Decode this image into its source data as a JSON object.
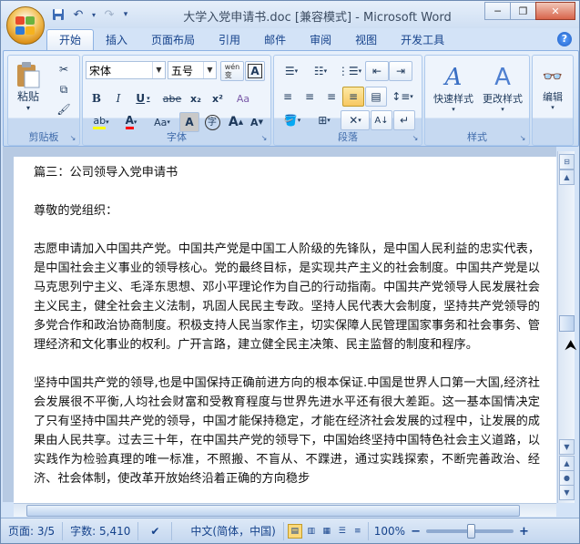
{
  "window": {
    "title": "大学入党申请书.doc [兼容模式] - Microsoft Word"
  },
  "tabs": [
    "开始",
    "插入",
    "页面布局",
    "引用",
    "邮件",
    "审阅",
    "视图",
    "开发工具"
  ],
  "ribbon": {
    "clipboard": {
      "label": "剪贴板",
      "paste": "粘贴"
    },
    "font": {
      "label": "字体",
      "font_name": "宋体",
      "font_size": "五号",
      "wen": "wén\n变",
      "a_box": "A",
      "bold": "B",
      "italic": "I",
      "underline": "U",
      "strike": "abe",
      "sub": "x₂",
      "sup": "x²",
      "clear": "Aa",
      "big_a": "A",
      "small_a": "A",
      "char_shade": "A",
      "char_circle": "字"
    },
    "paragraph": {
      "label": "段落"
    },
    "styles": {
      "label": "样式",
      "quick": "快速样式",
      "change": "更改样式"
    },
    "edit": {
      "label": "编辑"
    }
  },
  "document": {
    "paragraphs": [
      "篇三：公司领导入党申请书",
      "",
      "尊敬的党组织：",
      "",
      "志愿申请加入中国共产党。中国共产党是中国工人阶级的先锋队，是中国人民利益的忠实代表，  是中国社会主义事业的领导核心。党的最终目标，是实现共产主义的社会制度。中国共产党是以马克思列宁主义、毛泽东思想、邓小平理论作为自己的行动指南。中国共产党领导人民发展社会主义民主，健全社会主义法制，巩固人民民主专政。坚持人民代表大会制度，坚持共产党领导的多党合作和政治协商制度。积极支持人民当家作主，切实保障人民管理国家事务和社会事务、管理经济和文化事业的权利。广开言路，建立健全民主决策、民主监督的制度和程序。",
      "",
      "坚持中国共产党的领导,也是中国保持正确前进方向的根本保证.中国是世界人口第一大国,经济社会发展很不平衡,人均社会财富和受教育程度与世界先进水平还有很大差距。这一基本国情决定了只有坚持中国共产党的领导，中国才能保持稳定，才能在经济社会发展的过程中，让发展的成果由人民共享。过去三十年，在中国共产党的领导下，中国始终坚持中国特色社会主义道路，以实践作为检验真理的唯一标准，不照搬、不盲从、不蹀进，通过实践探索，不断完善政治、经济、社会体制，使改革开放始终沿着正确的方向稳步"
    ]
  },
  "status": {
    "page": "页面: 3/5",
    "words": "字数: 5,410",
    "language": "中文(简体，中国)",
    "zoom": "100%"
  }
}
